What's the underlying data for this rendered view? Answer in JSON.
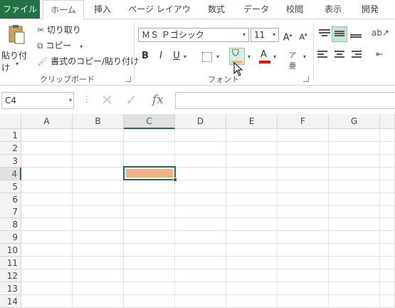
{
  "tabs": [
    {
      "label": "ファイル"
    },
    {
      "label": "ホーム"
    },
    {
      "label": "挿入"
    },
    {
      "label": "ページ レイアウト"
    },
    {
      "label": "数式"
    },
    {
      "label": "データ"
    },
    {
      "label": "校閲"
    },
    {
      "label": "表示"
    },
    {
      "label": "開発"
    }
  ],
  "clipboard": {
    "paste_label": "貼り付け",
    "cut_label": "切り取り",
    "copy_label": "コピー",
    "format_painter_label": "書式のコピー/貼り付け",
    "group_label": "クリップボード"
  },
  "font": {
    "font_name": "ＭＳ Ｐゴシック",
    "font_size": "11",
    "bold": "B",
    "italic": "I",
    "underline": "U",
    "group_label": "フォント",
    "fill_color": "#f4b183",
    "font_color": "#ff0000"
  },
  "formula_bar": {
    "name_box": "C4",
    "fx": "fx",
    "value": ""
  },
  "columns": [
    "A",
    "B",
    "C",
    "D",
    "E",
    "F",
    "G"
  ],
  "rows": [
    "1",
    "2",
    "3",
    "4",
    "5",
    "6",
    "7",
    "8",
    "9",
    "10",
    "11",
    "12",
    "13",
    "14"
  ],
  "selection": {
    "cell": "C4",
    "column": "C",
    "row": "4",
    "fill": "#f4b183"
  },
  "accent": "#217346"
}
